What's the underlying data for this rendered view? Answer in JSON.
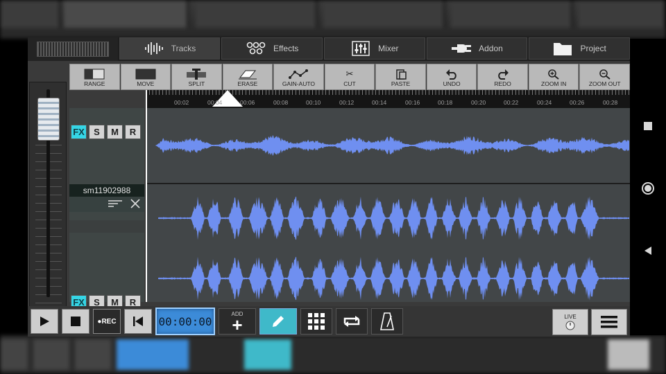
{
  "tabs": [
    {
      "label": "Tracks",
      "icon": "waveform-icon",
      "active": true
    },
    {
      "label": "Effects",
      "icon": "effects-icon",
      "active": false
    },
    {
      "label": "Mixer",
      "icon": "mixer-sliders-icon",
      "active": false
    },
    {
      "label": "Addon",
      "icon": "plug-icon",
      "active": false
    },
    {
      "label": "Project",
      "icon": "folder-icon",
      "active": false
    }
  ],
  "toolbar": {
    "range": "RANGE",
    "move": "MOVE",
    "split": "SPLIT",
    "erase": "ERASE",
    "gain_auto": "GAIN-AUTO",
    "cut": "CUT",
    "paste": "PASTE",
    "undo": "UNDO",
    "redo": "REDO",
    "zoom_in": "ZOOM IN",
    "zoom_out": "ZOOM OUT"
  },
  "ruler": {
    "labels": [
      "00:02",
      "00:04",
      "00:06",
      "00:08",
      "00:10",
      "00:12",
      "00:14",
      "00:16",
      "00:18",
      "00:20",
      "00:22",
      "00:24",
      "00:26",
      "00:28"
    ]
  },
  "tracks": [
    {
      "fx": "FX",
      "solo": "S",
      "mute": "M",
      "record": "R",
      "name": "sm11902988"
    },
    {
      "fx": "FX",
      "solo": "S",
      "mute": "M",
      "record": "R"
    }
  ],
  "transport": {
    "time": "00:00:00",
    "rec_label": "●REC",
    "add_label": "ADD",
    "live_label": "LIVE"
  },
  "colors": {
    "waveform": "#6f8ff0",
    "fx_active": "#35d6e6",
    "time_display": "#3c8bd8",
    "pencil_active": "#3fb9c9"
  }
}
